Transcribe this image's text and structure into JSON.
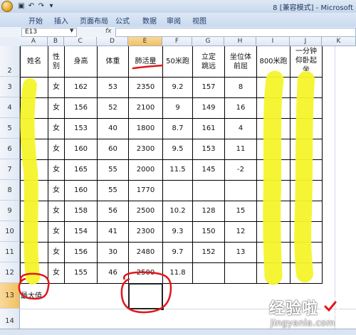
{
  "window": {
    "title": "8 [兼容模式] - Microsoft"
  },
  "ribbon": {
    "tabs": [
      "开始",
      "插入",
      "页面布局",
      "公式",
      "数据",
      "审阅",
      "视图"
    ]
  },
  "formula_bar": {
    "name_box": "E13",
    "fx_label": "fx",
    "value": ""
  },
  "columns": [
    "A",
    "B",
    "C",
    "D",
    "E",
    "F",
    "G",
    "H",
    "I",
    "J",
    "K"
  ],
  "selected_column": "E",
  "selected_row": "13",
  "header_row": {
    "row_label": "2",
    "cells": [
      "姓名",
      "性别",
      "身高",
      "体重",
      "肺活量",
      "50米跑",
      "立定跳远",
      "坐位体前屈",
      "800米跑",
      "一分钟仰卧起坐",
      ""
    ]
  },
  "rows": [
    {
      "label": "3",
      "cells": [
        "",
        "女",
        "162",
        "53",
        "2350",
        "9.2",
        "157",
        "8",
        "",
        ""
      ]
    },
    {
      "label": "4",
      "cells": [
        "",
        "女",
        "156",
        "52",
        "2100",
        "9",
        "149",
        "16",
        "",
        ""
      ]
    },
    {
      "label": "5",
      "cells": [
        "",
        "女",
        "153",
        "40",
        "1800",
        "8.7",
        "161",
        "4",
        "",
        ""
      ]
    },
    {
      "label": "6",
      "cells": [
        "",
        "女",
        "160",
        "60",
        "2300",
        "9.5",
        "153",
        "11",
        "",
        ""
      ]
    },
    {
      "label": "7",
      "cells": [
        "",
        "女",
        "165",
        "55",
        "2000",
        "11.5",
        "145",
        "-2",
        "",
        ""
      ]
    },
    {
      "label": "8",
      "cells": [
        "",
        "女",
        "160",
        "55",
        "1770",
        "",
        "",
        "",
        "",
        ""
      ]
    },
    {
      "label": "9",
      "cells": [
        "",
        "女",
        "158",
        "56",
        "2500",
        "10.2",
        "128",
        "15",
        "",
        ""
      ]
    },
    {
      "label": "10",
      "cells": [
        "",
        "女",
        "154",
        "41",
        "2300",
        "9.3",
        "150",
        "12",
        "",
        ""
      ]
    },
    {
      "label": "11",
      "cells": [
        "",
        "女",
        "156",
        "30",
        "2480",
        "9.7",
        "152",
        "13",
        "",
        ""
      ]
    },
    {
      "label": "12",
      "cells": [
        "",
        "女",
        "155",
        "46",
        "2500",
        "11.8",
        "",
        "",
        "",
        ""
      ]
    },
    {
      "label": "13",
      "cells": [
        "最大值",
        "",
        "",
        "",
        "",
        "",
        "",
        "",
        "",
        ""
      ]
    },
    {
      "label": "14",
      "cells": [
        "",
        "",
        "",
        "",
        "",
        "",
        "",
        "",
        "",
        ""
      ]
    }
  ],
  "watermark": {
    "main": "经验啦",
    "check": "✓",
    "sub": "jingyanla.com"
  },
  "colors": {
    "highlighter": "#f4f42a",
    "annotation": "#e2161b",
    "header_selected": "#f1c15f"
  }
}
